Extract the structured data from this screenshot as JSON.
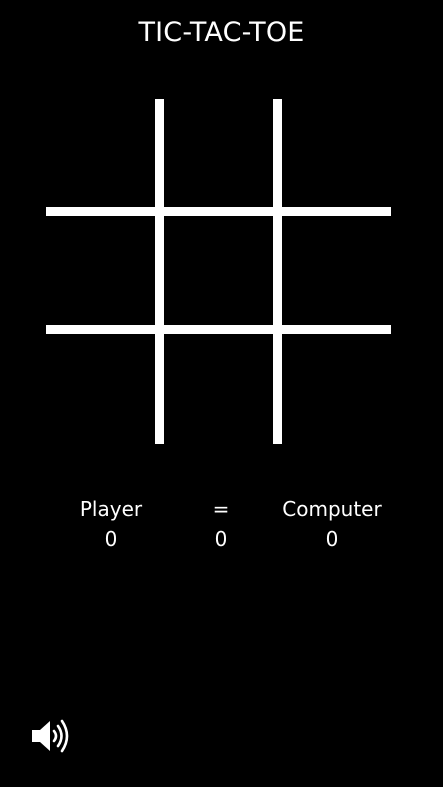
{
  "title": "TIC-TAC-TOE",
  "board": {
    "cells": [
      "",
      "",
      "",
      "",
      "",
      "",
      "",
      "",
      ""
    ]
  },
  "scoreboard": {
    "player": {
      "label": "Player",
      "value": "0"
    },
    "draw": {
      "label": "=",
      "value": "0"
    },
    "computer": {
      "label": "Computer",
      "value": "0"
    }
  },
  "controls": {
    "sound_icon": "speaker-icon"
  },
  "colors": {
    "background": "#000000",
    "foreground": "#ffffff"
  }
}
